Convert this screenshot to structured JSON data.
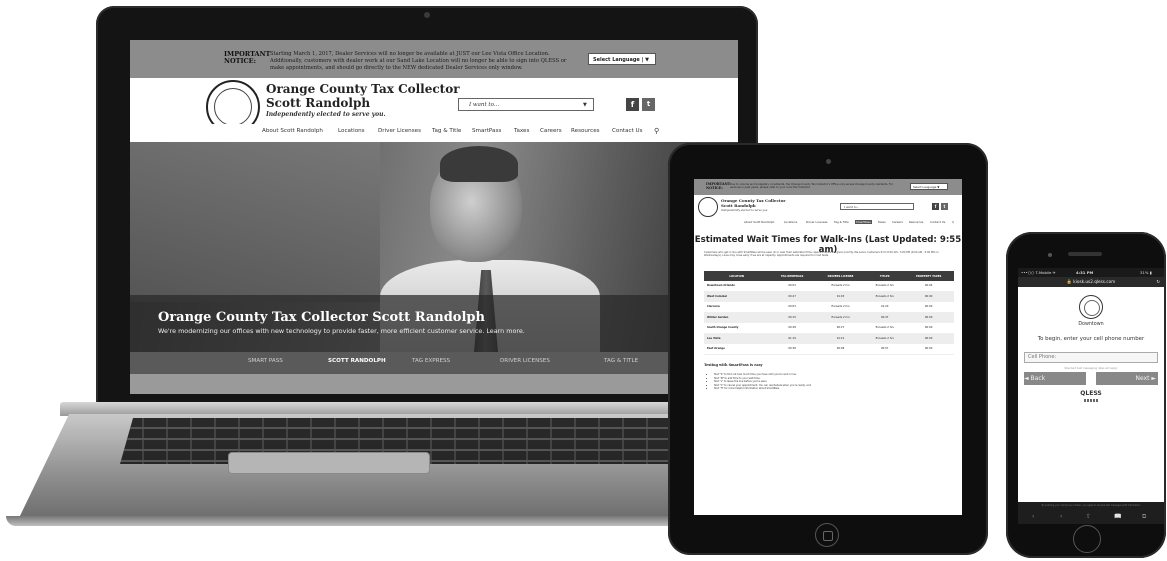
{
  "laptop": {
    "notice": {
      "heading": "IMPORTANT NOTICE:",
      "text": "Starting March 1, 2017, Dealer Services will no longer be available at JUST our Lee Vista Office Location. Additionally, customers with dealer work at our Sand Lake Location will no longer be able to sign into QLESS or make appointments, and should go directly to the NEW dedicated Dealer Services only window.",
      "language_button": "Select Language | ▼"
    },
    "header": {
      "title_line1": "Orange County Tax Collector",
      "title_line2": "Scott Randolph",
      "tagline": "Independently elected to serve you.",
      "select_placeholder": "I want to...",
      "facebook": "f",
      "twitter": "t"
    },
    "nav": [
      "About Scott Randolph",
      "Locations",
      "Driver Licenses",
      "Tag & Title",
      "SmartPass",
      "Taxes",
      "Careers",
      "Resources",
      "Contact Us"
    ],
    "hero": {
      "title": "Orange County Tax Collector Scott Randolph",
      "subtitle": "We're modernizing our offices with new technology to provide faster, more efficient customer service. Learn more."
    },
    "tabs": [
      "SMART PASS",
      "SCOTT RANDOLPH",
      "TAG EXPRESS",
      "DRIVER LICENSES",
      "TAG & TITLE"
    ],
    "active_tab": "SCOTT RANDOLPH"
  },
  "tablet": {
    "notice": {
      "heading": "IMPORTANT NOTICE:",
      "text": "Due to volume and budgetary constraints, the Orange County Tax Collector's Office only serves Orange County residents. For services in past years, please refer to your local Tax Collector.",
      "language_button": "Select Language ▼"
    },
    "header": {
      "title_line1": "Orange County Tax Collector",
      "title_line2": "Scott Randolph",
      "tagline": "Independently elected to serve you.",
      "select_placeholder": "I want to...",
      "facebook": "f",
      "twitter": "t"
    },
    "nav": [
      "About Scott Randolph",
      "Locations",
      "Driver Licenses",
      "Tag & Title",
      "SmartPass",
      "Taxes",
      "Careers",
      "Resources",
      "Contact Us"
    ],
    "active_nav": "SmartPass",
    "page_title": "Estimated Wait Times for Walk-Ins (Last Updated: 9:55 am)",
    "intro": "Customers who get in line with SmartPass will be seen at or near their estimated time; appointments are given priority. We serve customers from 8:30 AM - 5:00 PM (9:00 AM - 5:00 PM on Wednesdays). Lines may close early if we are at capacity. Appointments are required for road tests.",
    "table": {
      "headers": [
        "LOCATION",
        "TAG RENEWALS",
        "DRIVERS LICENSE",
        "TITLES",
        "PROPERTY TAXES"
      ],
      "rows": [
        [
          "Downtown Orlando",
          "00:03",
          "Exceeds 2 hrs",
          "Exceeds 2 hrs",
          "00:04"
        ],
        [
          "West Colonial",
          "00:47",
          "01:03",
          "Exceeds 2 hrs",
          "00:00"
        ],
        [
          "Clarcona",
          "00:03",
          "Exceeds 2 hrs",
          "01:20",
          "00:00"
        ],
        [
          "Winter Garden",
          "00:15",
          "Exceeds 2 hrs",
          "00:47",
          "00:00"
        ],
        [
          "South Orange County",
          "00:28",
          "00:27",
          "Exceeds 2 hrs",
          "00:00"
        ],
        [
          "Lee Vista",
          "01:19",
          "01:21",
          "Exceeds 2 hrs",
          "00:00"
        ],
        [
          "East Orange",
          "00:38",
          "00:08",
          "00:57",
          "00:00"
        ]
      ]
    },
    "texting_title": "Texting with SmartPass is easy",
    "texting_items": [
      "Text \"S\" to find out how much time you have until you're next in line.",
      "Text \"M\" to add time to your wait time.",
      "Text \"L\" to leave the line before you're seen.",
      "Text \"C\" to cancel your appointment. You can reschedule when you're ready, and",
      "Text \"H\" for more helpful information about SmartPass."
    ]
  },
  "phone": {
    "status": {
      "carrier": "•••○○ T-Mobile ✈",
      "time": "4:31 PM",
      "battery": "31% ▮"
    },
    "url": "🔒 kiosk.us2.qless.com",
    "reload": "↻",
    "location": "Downtown",
    "prompt": "To begin, enter your cell phone number",
    "input_placeholder": "Cell Phone:",
    "hint": "Standard text messaging rates will apply",
    "back": "◄ Back",
    "next": "Next ►",
    "brand": "QLESS",
    "disclaimer": "By entering your cell phone number, you agree to receive text messages with information",
    "toolbar": [
      "‹",
      "›",
      "⇧",
      "📖",
      "⧉"
    ]
  }
}
